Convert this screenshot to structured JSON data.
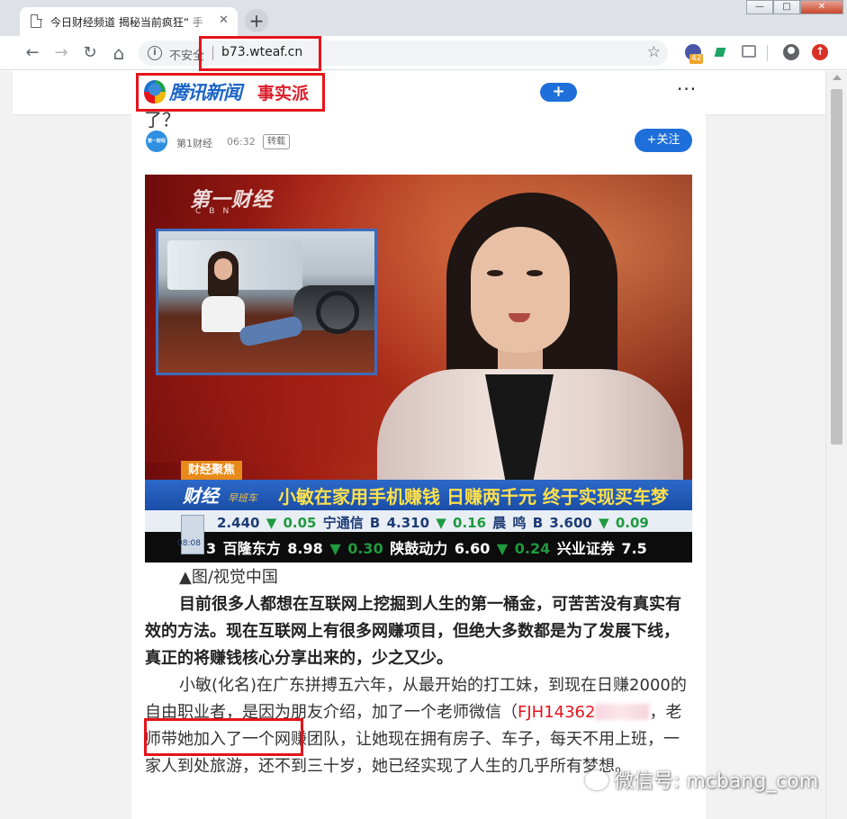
{
  "browser": {
    "tab_title": "今日财经频道 揭秘当前疯狂“ 手",
    "tab_close": "✕",
    "new_tab": "+",
    "window_controls": {
      "minimize": "—",
      "maximize": "□",
      "close": "✕"
    },
    "nav": {
      "back": "←",
      "forward": "→",
      "reload": "↻",
      "home": "⌂"
    },
    "info_icon": "i",
    "security_label": "不安全",
    "url": "b73.wteaf.cn",
    "bookmark_icon": "☆",
    "extensions": [
      {
        "name": "extension-icon",
        "badge": "42"
      },
      {
        "name": "flag-extension-icon"
      },
      {
        "name": "store-extension-icon"
      }
    ],
    "update_icon": "↑"
  },
  "site": {
    "logo_text": "腾讯新闻",
    "logo_sub": "事实派",
    "plus_label": "+",
    "more_label": "···"
  },
  "article": {
    "title_fragment": "了？",
    "author": {
      "avatar_text": "第一财经",
      "name": "第1财经",
      "time": "06:32",
      "tag": "转载"
    },
    "follow_label": "+关注",
    "image": {
      "channel_logo": "第一财经",
      "channel_sub": "CBN",
      "segment_label": "财经聚焦",
      "show_name": "财经",
      "show_sub": "早班车",
      "headline": "小敏在家用手机赚钱 日赚两千元 终于实现买车梦",
      "clock": "08:08",
      "stock_row_1": {
        "before": "2.440",
        "v1": "▼ 0.05",
        "mid1": "宁通信 B  4.310",
        "v2": "▼ 0.16",
        "mid2": "晨 鸣 B  3.600",
        "v3": "▼ 0.09"
      },
      "stock_row_2": {
        "before": "3  百隆东方 8.98",
        "v1": "▼ 0.30",
        "mid1": "陕鼓动力 6.60",
        "v2": "▼ 0.24",
        "mid2": "兴业证券 7.5"
      }
    },
    "caption": "▲图/视觉中国",
    "paragraph_bold": "目前很多人都想在互联网上挖掘到人生的第一桶金，可苦苦没有真实有效的方法。现在互联网上有很多网赚项目，但绝大多数都是为了发展下线，真正的将赚钱核心分享出来的，少之又少。",
    "paragraph_2_a": "小敏(化名)在广东拼搏五六年，从最开始的打工妹，到现在日赚2000的自由职业者，是因为朋友介绍，加了一个老师微信",
    "wechat_open": "（",
    "wechat_id": "FJH14362",
    "paragraph_2_b": "，老师带她加入了一个网赚团队，让她现在拥有房子、车子，每天不用上班，一家人到处旅游，还不到三十岁，她已经实现了人生的几乎所有梦想。"
  },
  "watermark": "微信号: mcbang_com",
  "colors": {
    "accent": "#1e6fd9",
    "highlight": "#e4141b"
  }
}
